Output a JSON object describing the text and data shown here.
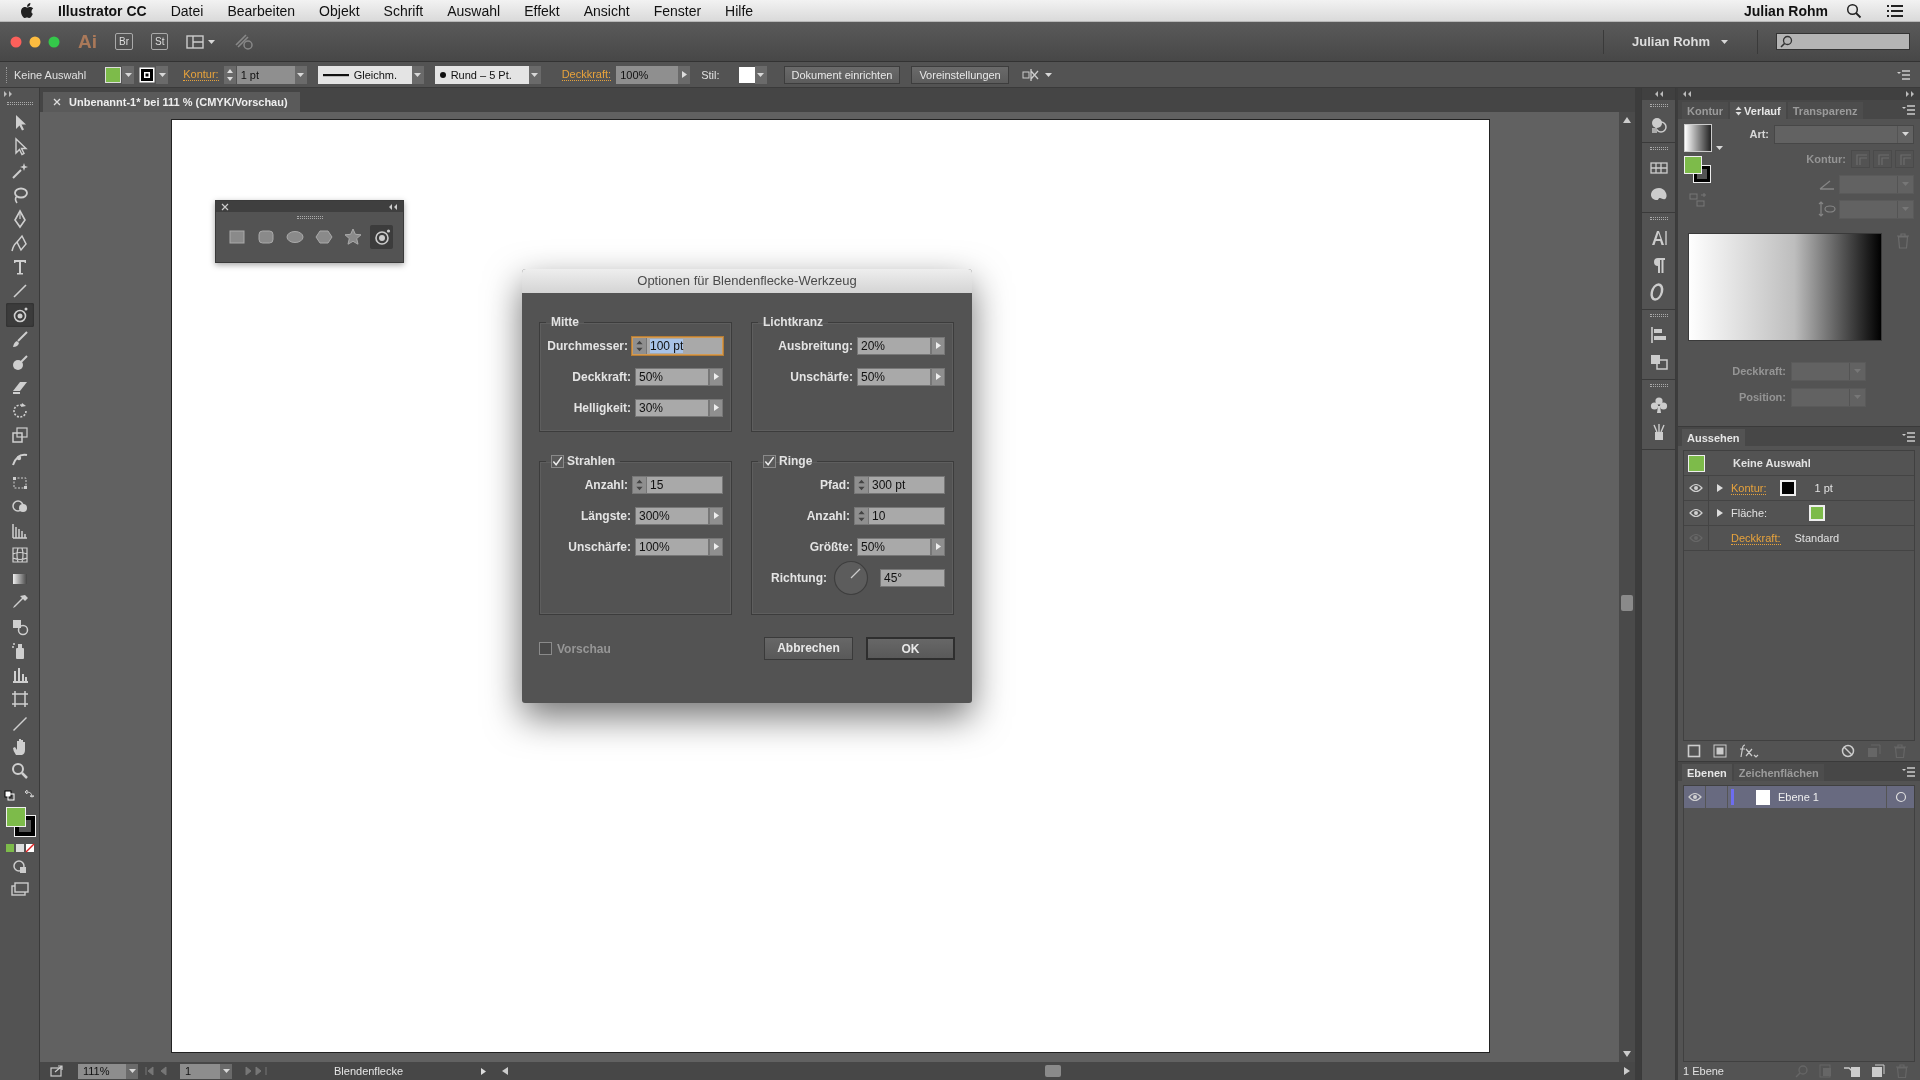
{
  "menubar": {
    "app": "Illustrator CC",
    "menus": [
      "Datei",
      "Bearbeiten",
      "Objekt",
      "Schrift",
      "Auswahl",
      "Effekt",
      "Ansicht",
      "Fenster",
      "Hilfe"
    ],
    "user": "Julian Rohm"
  },
  "app_bar": {
    "logo": "Ai",
    "apps": [
      "Br",
      "St"
    ],
    "workspace": "Julian Rohm"
  },
  "control_bar": {
    "selection": "Keine Auswahl",
    "stroke_label": "Kontur:",
    "stroke_weight": "1 pt",
    "stroke_profile": "Gleichm.",
    "brush": "Rund – 5 Pt.",
    "opacity_label": "Deckkraft:",
    "opacity": "100%",
    "style_label": "Stil:",
    "buttons": [
      "Dokument einrichten",
      "Voreinstellungen"
    ]
  },
  "document_tab": {
    "title": "Unbenannt-1* bei 111 % (CMYK/Vorschau)"
  },
  "toolbox": {
    "tools": [
      {
        "kind": "selection",
        "selected": false
      },
      {
        "kind": "direct",
        "selected": false
      },
      {
        "kind": "wand",
        "selected": false
      },
      {
        "kind": "lasso",
        "selected": false
      },
      {
        "kind": "pen",
        "selected": false
      },
      {
        "kind": "curvature",
        "selected": false
      },
      {
        "kind": "type",
        "selected": false
      },
      {
        "kind": "line",
        "selected": false
      },
      {
        "kind": "flare",
        "selected": true
      },
      {
        "kind": "brush",
        "selected": false
      },
      {
        "kind": "blob",
        "selected": false
      },
      {
        "kind": "eraser",
        "selected": false
      },
      {
        "kind": "rotate",
        "selected": false
      },
      {
        "kind": "scale",
        "selected": false
      },
      {
        "kind": "width",
        "selected": false
      },
      {
        "kind": "transform",
        "selected": false
      },
      {
        "kind": "builder",
        "selected": false
      },
      {
        "kind": "perspective",
        "selected": false
      },
      {
        "kind": "mesh",
        "selected": false
      },
      {
        "kind": "gradient",
        "selected": false
      },
      {
        "kind": "eyedropper",
        "selected": false
      },
      {
        "kind": "blend",
        "selected": false
      },
      {
        "kind": "sprayer",
        "selected": false
      },
      {
        "kind": "graph",
        "selected": false
      },
      {
        "kind": "artboard",
        "selected": false
      },
      {
        "kind": "slice",
        "selected": false
      },
      {
        "kind": "hand",
        "selected": false
      },
      {
        "kind": "zoom",
        "selected": false
      }
    ]
  },
  "shape_panel": {
    "tools": [
      {
        "kind": "rectangle",
        "selected": false
      },
      {
        "kind": "rounded",
        "selected": false
      },
      {
        "kind": "ellipse",
        "selected": false
      },
      {
        "kind": "polygon",
        "selected": false
      },
      {
        "kind": "star",
        "selected": false
      },
      {
        "kind": "flare",
        "selected": true
      }
    ]
  },
  "dialog": {
    "title": "Optionen für Blendenflecke-Werkzeug",
    "groups": [
      {
        "title": "Mitte",
        "kind": "plain",
        "fields": [
          {
            "label": "Durchmesser:",
            "value": "100 pt",
            "kind": "stepper",
            "focused": true
          },
          {
            "label": "Deckkraft:",
            "value": "50%",
            "kind": "popup",
            "focused": false
          },
          {
            "label": "Helligkeit:",
            "value": "30%",
            "kind": "popup",
            "focused": false
          }
        ]
      },
      {
        "title": "Lichtkranz",
        "kind": "plain",
        "fields": [
          {
            "label": "Ausbreitung:",
            "value": "20%",
            "kind": "popup",
            "focused": false
          },
          {
            "label": "Unschärfe:",
            "value": "50%",
            "kind": "popup",
            "focused": false
          }
        ]
      },
      {
        "title": "Strahlen",
        "kind": "checkbox",
        "checked": true,
        "fields": [
          {
            "label": "Anzahl:",
            "value": "15",
            "kind": "stepper",
            "focused": false
          },
          {
            "label": "Längste:",
            "value": "300%",
            "kind": "popup",
            "focused": false
          },
          {
            "label": "Unschärfe:",
            "value": "100%",
            "kind": "popup",
            "focused": false
          }
        ]
      },
      {
        "title": "Ringe",
        "kind": "checkbox",
        "checked": true,
        "fields": [
          {
            "label": "Pfad:",
            "value": "300 pt",
            "kind": "stepper",
            "focused": false
          },
          {
            "label": "Anzahl:",
            "value": "10",
            "kind": "stepper",
            "focused": false
          },
          {
            "label": "Größte:",
            "value": "50%",
            "kind": "popup",
            "focused": false
          },
          {
            "label": "Richtung:",
            "value": "45°",
            "kind": "angle",
            "focused": false
          }
        ]
      }
    ],
    "preview": {
      "label": "Vorschau",
      "checked": false,
      "disabled": true
    },
    "buttons": [
      {
        "label": "Abbrechen",
        "default": false
      },
      {
        "label": "OK",
        "default": true
      }
    ]
  },
  "status_bar": {
    "zoom": "111%",
    "artboard": "1",
    "current_tool": "Blendenflecke"
  },
  "gradient_panel": {
    "tabs": [
      {
        "label": "Kontur",
        "selected": false
      },
      {
        "label": "Verlauf",
        "selected": true
      },
      {
        "label": "Transparenz",
        "selected": false
      }
    ],
    "fields": [
      {
        "kind": "type",
        "label": "Art:",
        "disabled": false
      },
      {
        "kind": "stroke",
        "label": "Kontur:",
        "disabled": true
      },
      {
        "kind": "angle",
        "disabled": true
      },
      {
        "kind": "aspect",
        "disabled": true
      }
    ],
    "stop_fields": [
      {
        "label": "Deckkraft:",
        "disabled": true
      },
      {
        "label": "Position:",
        "disabled": true
      }
    ]
  },
  "appearance_panel": {
    "title": "Aussehen",
    "header": "Keine Auswahl",
    "rows": [
      {
        "kind": "stroke",
        "label": "Kontur:",
        "color": "#000000",
        "value": "1 pt",
        "visible": true
      },
      {
        "kind": "fill",
        "label": "Fläche:",
        "color": "#7dbb4a",
        "visible": true
      },
      {
        "kind": "opacity",
        "label": "Deckkraft:",
        "value": "Standard",
        "visible": false
      }
    ]
  },
  "layers_panel": {
    "tabs": [
      {
        "label": "Ebenen",
        "selected": true
      },
      {
        "label": "Zeichenflächen",
        "selected": false
      }
    ],
    "layers": [
      {
        "name": "Ebene 1",
        "selected": true,
        "visible": true
      }
    ],
    "count": "1 Ebene"
  }
}
